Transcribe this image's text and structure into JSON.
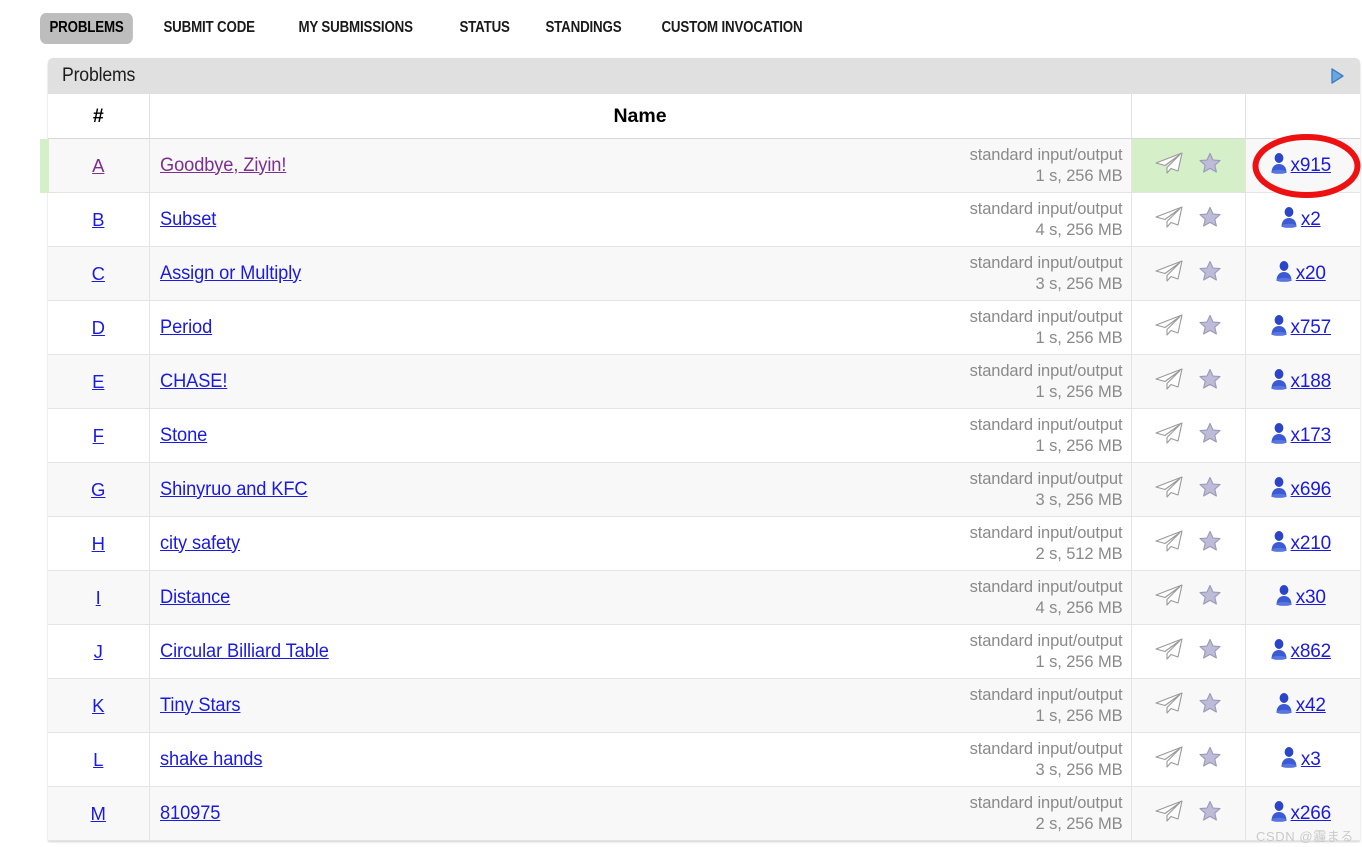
{
  "nav": {
    "tabs": [
      {
        "label": "PROBLEMS",
        "active": true
      },
      {
        "label": "SUBMIT CODE",
        "active": false
      },
      {
        "label": "MY SUBMISSIONS",
        "active": false
      },
      {
        "label": "STATUS",
        "active": false
      },
      {
        "label": "STANDINGS",
        "active": false
      },
      {
        "label": "CUSTOM INVOCATION",
        "active": false
      }
    ]
  },
  "panel": {
    "caption": "Problems",
    "next_arrow_icon": "triangle-right-icon",
    "accent_color": "#4a90d9"
  },
  "table": {
    "headers": {
      "index": "#",
      "name": "Name",
      "actions": "",
      "count": ""
    },
    "icons": {
      "submit": "paper-plane-icon",
      "favorite": "star-icon",
      "solvers": "user-icon"
    },
    "rows": [
      {
        "index": "A",
        "name": "Goodbye, Ziyin!",
        "io": "standard input/output",
        "limits": "1 s, 256 MB",
        "count": "x915",
        "solved": true,
        "visited": true
      },
      {
        "index": "B",
        "name": "Subset",
        "io": "standard input/output",
        "limits": "4 s, 256 MB",
        "count": "x2",
        "solved": false,
        "visited": false
      },
      {
        "index": "C",
        "name": "Assign or Multiply",
        "io": "standard input/output",
        "limits": "3 s, 256 MB",
        "count": "x20",
        "solved": false,
        "visited": false
      },
      {
        "index": "D",
        "name": "Period",
        "io": "standard input/output",
        "limits": "1 s, 256 MB",
        "count": "x757",
        "solved": false,
        "visited": false
      },
      {
        "index": "E",
        "name": "CHASE!",
        "io": "standard input/output",
        "limits": "1 s, 256 MB",
        "count": "x188",
        "solved": false,
        "visited": false
      },
      {
        "index": "F",
        "name": "Stone",
        "io": "standard input/output",
        "limits": "1 s, 256 MB",
        "count": "x173",
        "solved": false,
        "visited": false
      },
      {
        "index": "G",
        "name": "Shinyruo and KFC",
        "io": "standard input/output",
        "limits": "3 s, 256 MB",
        "count": "x696",
        "solved": false,
        "visited": false
      },
      {
        "index": "H",
        "name": "city safety",
        "io": "standard input/output",
        "limits": "2 s, 512 MB",
        "count": "x210",
        "solved": false,
        "visited": false
      },
      {
        "index": "I",
        "name": "Distance",
        "io": "standard input/output",
        "limits": "4 s, 256 MB",
        "count": "x30",
        "solved": false,
        "visited": false
      },
      {
        "index": "J",
        "name": "Circular Billiard Table",
        "io": "standard input/output",
        "limits": "1 s, 256 MB",
        "count": "x862",
        "solved": false,
        "visited": false
      },
      {
        "index": "K",
        "name": "Tiny Stars",
        "io": "standard input/output",
        "limits": "1 s, 256 MB",
        "count": "x42",
        "solved": false,
        "visited": false
      },
      {
        "index": "L",
        "name": "shake hands",
        "io": "standard input/output",
        "limits": "3 s, 256 MB",
        "count": "x3",
        "solved": false,
        "visited": false
      },
      {
        "index": "M",
        "name": "810975",
        "io": "standard input/output",
        "limits": "2 s, 256 MB",
        "count": "x266",
        "solved": false,
        "visited": false
      }
    ]
  },
  "annotation": {
    "shape": "ellipse",
    "color": "#ee1111",
    "target": "x915"
  },
  "watermark": "CSDN @霾まる"
}
